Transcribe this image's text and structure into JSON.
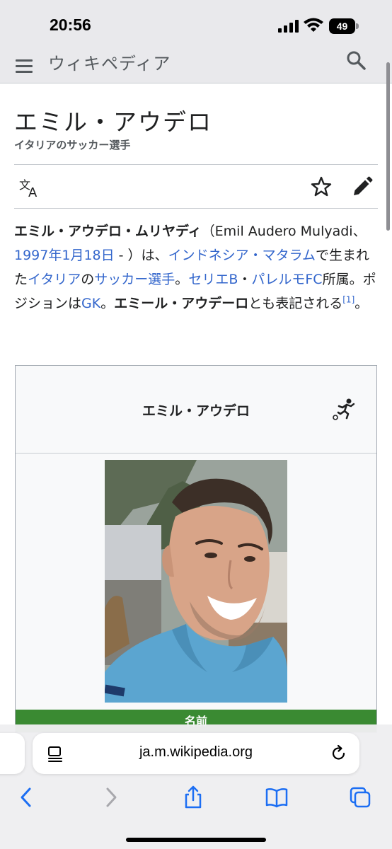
{
  "status_bar": {
    "time": "20:56",
    "battery": "49"
  },
  "header": {
    "wordmark": "ウィキペディア"
  },
  "article": {
    "title": "エミル・アウデロ",
    "subtitle": "イタリアのサッカー選手",
    "lead": {
      "bold_name": "エミル・アウデロ・ムリヤディ",
      "latin_name": "（Emil Audero Mulyadi、",
      "birth_date": "1997年1月18日",
      "after_date": " - ）は、",
      "birthplace": "インドネシア・マタラム",
      "born_in": "で生まれた",
      "nationality": "イタリア",
      "of": "の",
      "occupation": "サッカー選手",
      "period": "。",
      "league": "セリエB",
      "middot": "・",
      "club": "パレルモFC",
      "affiliation": "所属。ポジションは",
      "position": "GK",
      "period2": "。",
      "alt_name": "エミール・アウデーロ",
      "alt_suffix": "とも表記される",
      "ref": "[1]",
      "end": "。"
    }
  },
  "infobox": {
    "title": "エミル・アウデロ",
    "name_header": "名前"
  },
  "safari": {
    "url": "ja.m.wikipedia.org"
  },
  "colors": {
    "link": "#3366cc",
    "infobox_header": "#3a8a32",
    "ios_blue": "#1c6ef3"
  }
}
